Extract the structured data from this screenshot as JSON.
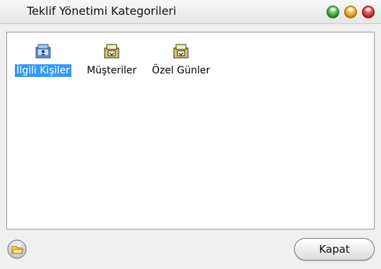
{
  "window": {
    "title": "Teklif Yönetimi Kategorileri"
  },
  "categories": [
    {
      "label": "İlgili Kişiler",
      "icon": "contacts-folder-icon",
      "selected": true
    },
    {
      "label": "Müşteriler",
      "icon": "folder-icon",
      "selected": false
    },
    {
      "label": "Özel Günler",
      "icon": "folder-icon",
      "selected": false
    }
  ],
  "footer": {
    "close_label": "Kapat",
    "left_icon": "open-folder-icon"
  },
  "colors": {
    "selection": "#3399ff"
  }
}
